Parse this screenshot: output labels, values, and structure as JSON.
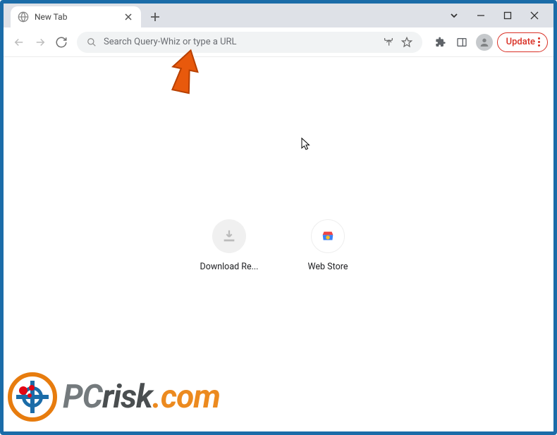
{
  "tab": {
    "label": "New Tab"
  },
  "omnibox": {
    "placeholder": "Search Query-Whiz or type a URL"
  },
  "toolbar": {
    "update_label": "Update"
  },
  "shortcuts": [
    {
      "label": "Download Re..."
    },
    {
      "label": "Web Store"
    }
  ],
  "logo": {
    "pc": "PC",
    "risk": "risk",
    "com": ".com"
  }
}
